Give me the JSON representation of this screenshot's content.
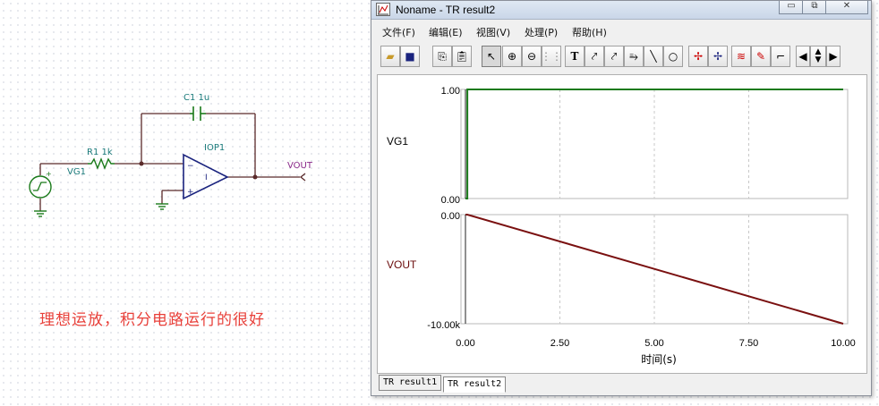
{
  "schematic": {
    "c1_label": "C1 1u",
    "r1_label": "R1 1k",
    "iop_label": "IOP1",
    "vout_label": "VOUT",
    "vg1_label": "VG1",
    "note": "理想运放，积分电路运行的很好"
  },
  "window": {
    "title": "Noname - TR result2",
    "controls": [
      "minimize-icon",
      "restore-icon",
      "close-icon"
    ],
    "menu": [
      "文件(F)",
      "编辑(E)",
      "视图(V)",
      "处理(P)",
      "帮助(H)"
    ],
    "toolbar_icons": [
      "open-folder-icon",
      "save-icon",
      "copy-icon",
      "paste-icon",
      "pointer-icon",
      "zoom-in-icon",
      "zoom-100-icon",
      "grid-icon",
      "text-icon",
      "cursor-a-icon",
      "cursor-b-icon",
      "cursor-c-icon",
      "line-icon",
      "circle-icon",
      "marker-a-icon",
      "marker-b-icon",
      "waves-icon",
      "probe-icon",
      "ramp-icon",
      "scroll-left-icon",
      "scroll-updown-icon",
      "scroll-right-icon"
    ],
    "tabs": [
      "TR result1",
      "TR result2"
    ],
    "active_tab": 1
  },
  "chart_data": {
    "type": "line",
    "xlabel": "时间(s)",
    "x_ticks": [
      "0.00",
      "2.50",
      "5.00",
      "7.50",
      "10.00"
    ],
    "xlim": [
      0,
      10
    ],
    "grid": "vertical dashed",
    "panels": [
      {
        "name": "VG1",
        "y_ticks": [
          "1.00",
          "0.00"
        ],
        "ylim": [
          0,
          1
        ],
        "color": "#1a7a1a",
        "x": [
          0,
          0.05,
          0.05,
          10
        ],
        "y": [
          0,
          0,
          1,
          1
        ]
      },
      {
        "name": "VOUT",
        "y_ticks": [
          "0.00",
          "-10.00k"
        ],
        "ylim": [
          -10000,
          0
        ],
        "color": "#7a1010",
        "x": [
          0,
          0.05,
          10
        ],
        "y": [
          0,
          0,
          -10000
        ]
      }
    ]
  }
}
